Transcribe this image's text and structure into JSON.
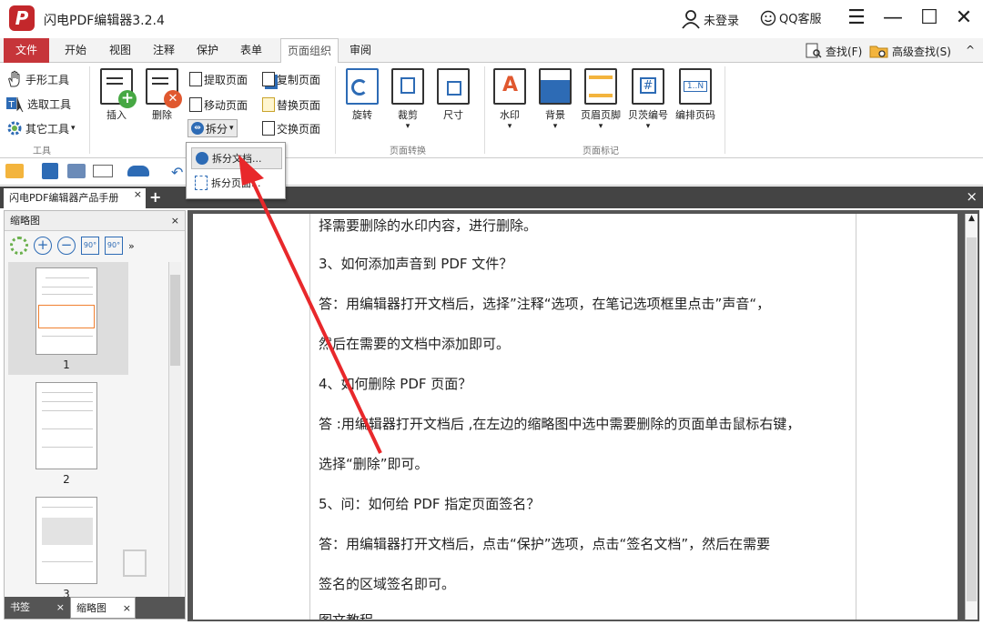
{
  "window": {
    "title": "闪电PDF编辑器3.2.4",
    "logo": "P",
    "login": "未登录",
    "qq": "QQ客服",
    "min": "—",
    "max": "☐",
    "close": "✕",
    "menu_icon": "☰"
  },
  "menu": {
    "items": [
      "文件",
      "开始",
      "视图",
      "注释",
      "保护",
      "表单",
      "页面组织",
      "审阅"
    ],
    "find": "查找(F)",
    "adv_find": "高级查找(S)",
    "collapse": "^"
  },
  "ribbon": {
    "tools": [
      "手形工具",
      "选取工具",
      "其它工具"
    ],
    "tools_group": "工具",
    "insert": "插入",
    "delete": "删除",
    "extract": "提取页面",
    "copy": "复制页面",
    "move": "移动页面",
    "replace": "替换页面",
    "split": "拆分",
    "swap": "交换页面",
    "rotate": "旋转",
    "crop": "裁剪",
    "size": "尺寸",
    "convert_group": "页面转换",
    "watermark": "水印",
    "background": "背景",
    "header_footer": "页眉页脚",
    "bates": "贝茨编号",
    "page_num": "编排页码",
    "mark_group": "页面标记",
    "page_num_icon": "1..N"
  },
  "dropdown": {
    "items": [
      "拆分文档...",
      "拆分页面..."
    ]
  },
  "tabs": {
    "doc": "闪电PDF编辑器产品手册",
    "close": "×",
    "new": "+",
    "bar_close": "×"
  },
  "sidebar": {
    "title": "缩略图",
    "close": "×",
    "pages": [
      "1",
      "2",
      "3"
    ],
    "bottom": [
      "书签",
      "缩略图"
    ]
  },
  "document": {
    "lines": [
      "择需要删除的水印内容，进行删除。",
      "3、如何添加声音到 PDF 文件？",
      "答：用编辑器打开文档后，选择”注释“选项，在笔记选项框里点击”声音“，",
      "然后在需要的文档中添加即可。",
      "4、如何删除 PDF 页面？",
      "答 :用编辑器打开文档后 ,在左边的缩略图中选中需要删除的页面单击鼠标右键，",
      "选择“删除”即可。",
      "5、问：如何给 PDF 指定页面签名？",
      "答：用编辑器打开文档后，点击“保护”选项，点击“签名文档”，然后在需要",
      "签名的区域签名即可。",
      "图文教程"
    ]
  },
  "colors": {
    "brand": "#c3272b",
    "arrow": "#e8282b"
  }
}
